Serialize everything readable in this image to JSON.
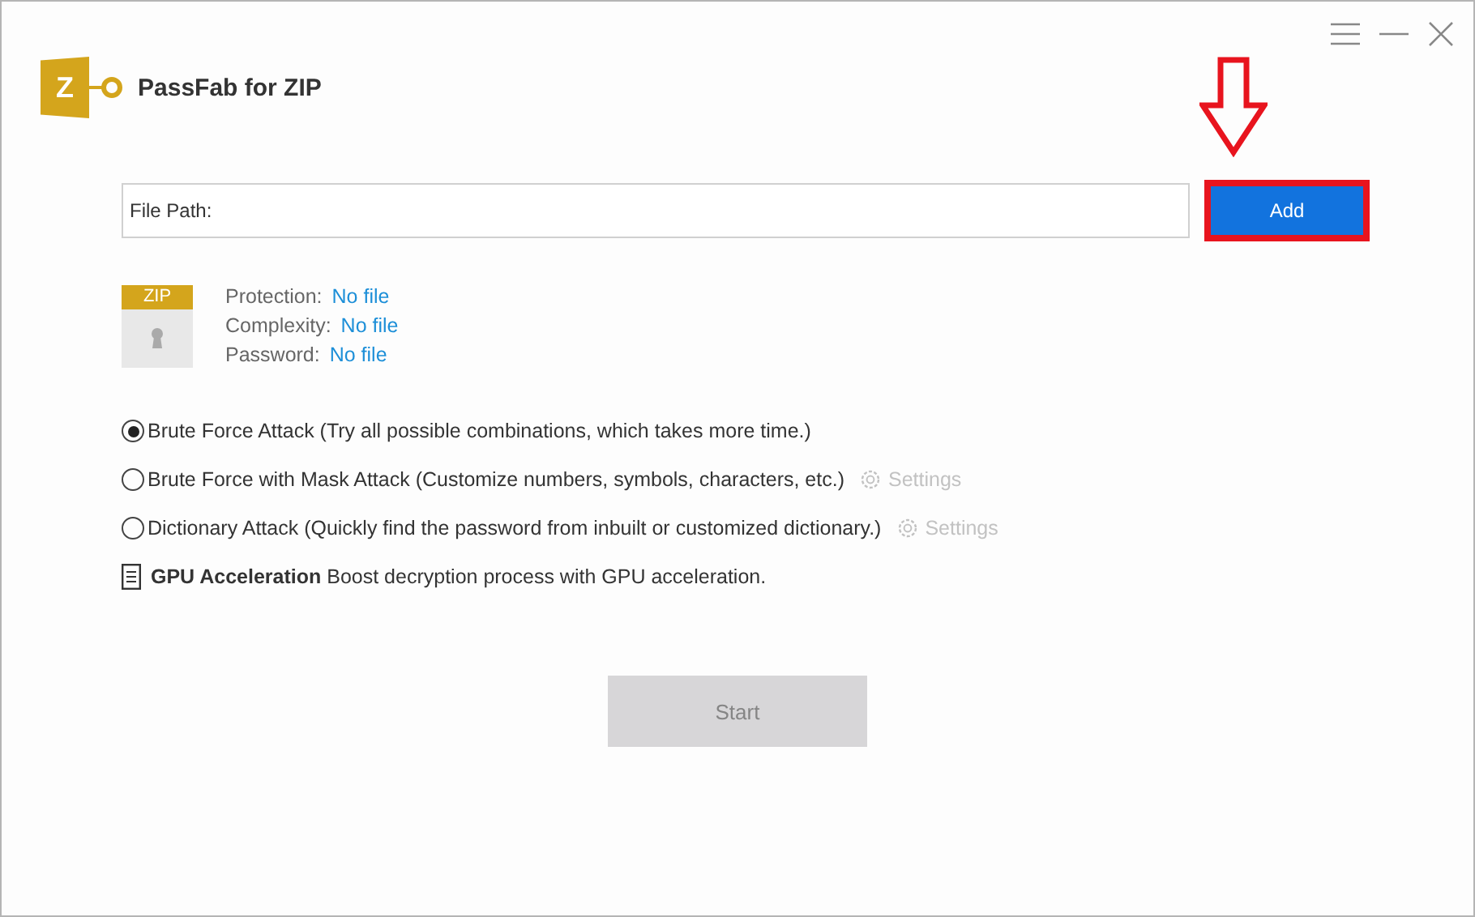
{
  "window": {
    "title": "PassFab for ZIP",
    "logo_letter": "Z"
  },
  "file_path": {
    "placeholder": "File Path:"
  },
  "add_button": {
    "label": "Add",
    "highlighted": true
  },
  "file_info": {
    "badge": "ZIP",
    "fields": [
      {
        "label": "Protection:",
        "value": "No file"
      },
      {
        "label": "Complexity:",
        "value": "No file"
      },
      {
        "label": "Password:",
        "value": "No file"
      }
    ]
  },
  "attack_modes": [
    {
      "label": "Brute Force Attack (Try all possible combinations, which takes more time.)",
      "selected": true
    },
    {
      "label": "Brute Force with Mask Attack (Customize numbers, symbols, characters, etc.)",
      "selected": false,
      "settings": {
        "label": "Settings",
        "disabled": true
      }
    },
    {
      "label": "Dictionary Attack (Quickly find the password from inbuilt or customized dictionary.)",
      "selected": false,
      "settings": {
        "label": "Settings",
        "disabled": true
      }
    }
  ],
  "gpu": {
    "text": "**GPU Acceleration** Boost decryption process with GPU acceleration."
  },
  "start_button": {
    "label": "Start",
    "disabled": true
  }
}
